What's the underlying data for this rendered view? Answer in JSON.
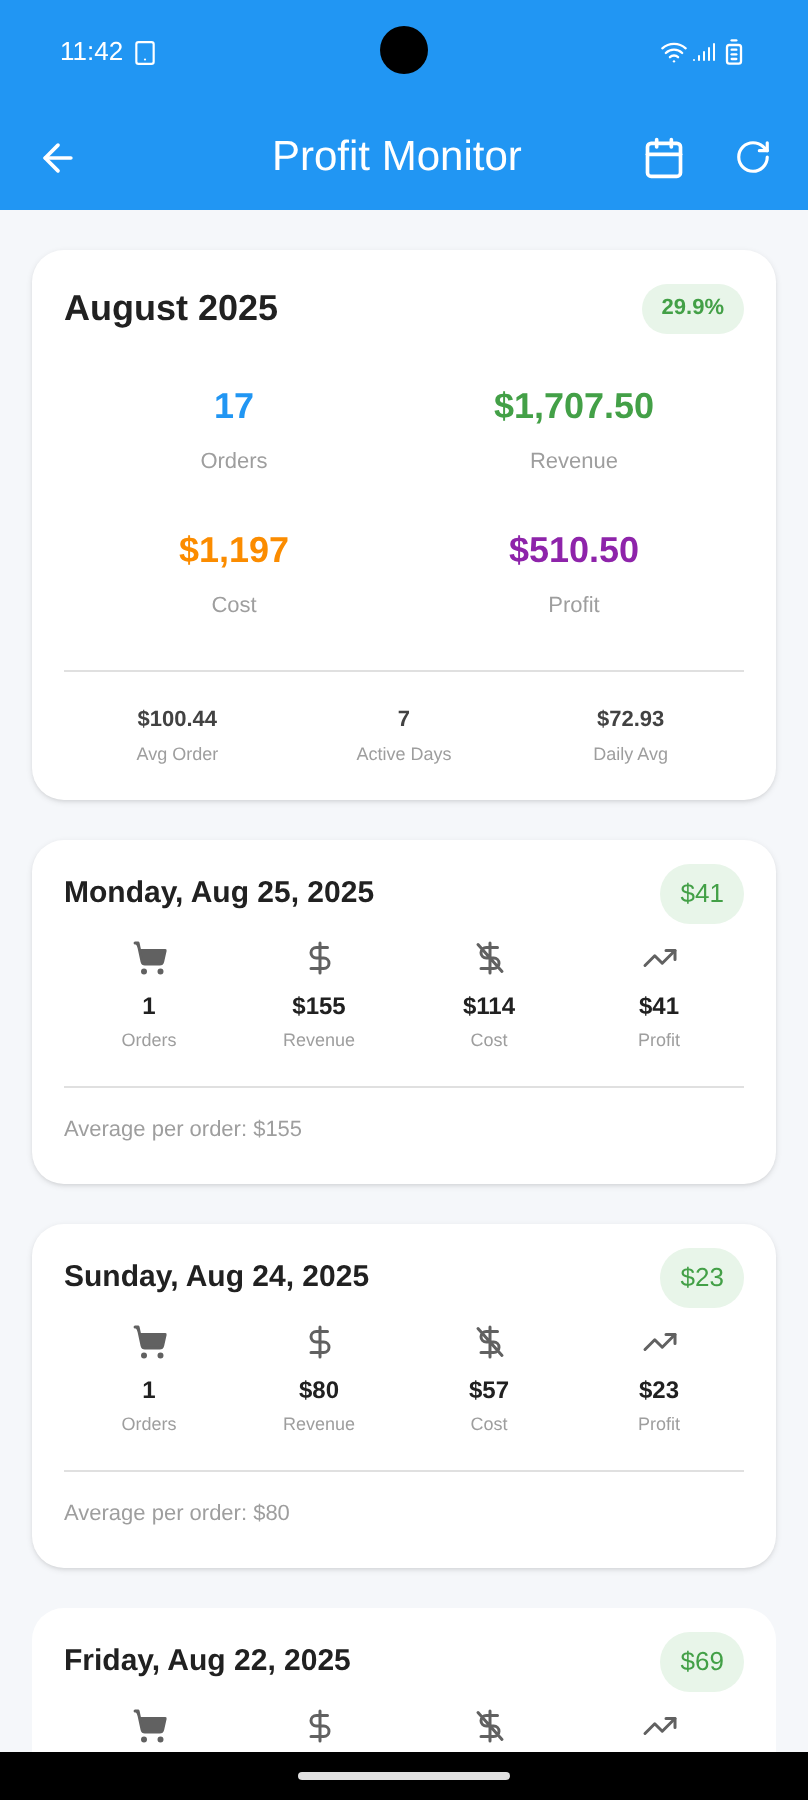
{
  "status_bar": {
    "time": "11:42"
  },
  "app_bar": {
    "title": "Profit Monitor"
  },
  "summary": {
    "title": "August 2025",
    "badge": "29.9%",
    "metrics": [
      {
        "value": "17",
        "label": "Orders",
        "color": "#2196f3"
      },
      {
        "value": "$1,707.50",
        "label": "Revenue",
        "color": "#43a047"
      },
      {
        "value": "$1,197",
        "label": "Cost",
        "color": "#fb8c00"
      },
      {
        "value": "$510.50",
        "label": "Profit",
        "color": "#8e24aa"
      }
    ],
    "footer": [
      {
        "value": "$100.44",
        "label": "Avg Order"
      },
      {
        "value": "7",
        "label": "Active Days"
      },
      {
        "value": "$72.93",
        "label": "Daily Avg"
      }
    ]
  },
  "days": [
    {
      "date": "Monday, Aug 25, 2025",
      "badge": "$41",
      "stats": [
        {
          "kind": "orders",
          "value": "1",
          "label": "Orders"
        },
        {
          "kind": "revenue",
          "value": "$155",
          "label": "Revenue"
        },
        {
          "kind": "cost",
          "value": "$114",
          "label": "Cost"
        },
        {
          "kind": "profit",
          "value": "$41",
          "label": "Profit"
        }
      ],
      "average": "Average per order: $155"
    },
    {
      "date": "Sunday, Aug 24, 2025",
      "badge": "$23",
      "stats": [
        {
          "kind": "orders",
          "value": "1",
          "label": "Orders"
        },
        {
          "kind": "revenue",
          "value": "$80",
          "label": "Revenue"
        },
        {
          "kind": "cost",
          "value": "$57",
          "label": "Cost"
        },
        {
          "kind": "profit",
          "value": "$23",
          "label": "Profit"
        }
      ],
      "average": "Average per order: $80"
    },
    {
      "date": "Friday, Aug 22, 2025",
      "badge": "$69",
      "stats": [
        {
          "kind": "orders"
        },
        {
          "kind": "revenue"
        },
        {
          "kind": "cost"
        },
        {
          "kind": "profit"
        }
      ]
    }
  ]
}
